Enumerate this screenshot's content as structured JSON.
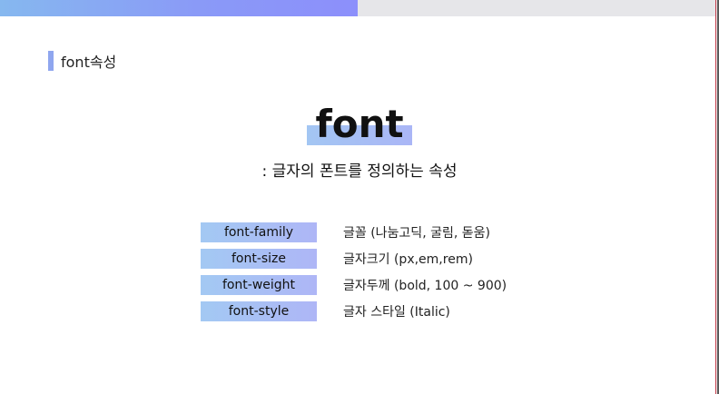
{
  "progress": {
    "fraction": 0.5,
    "fill_color": "#8a9af7",
    "track_color": "#e6e6e9"
  },
  "section": {
    "label": "font속성",
    "bar_color": "#8fa6ef"
  },
  "hero": {
    "word": "font",
    "subtitle": ": 글자의 폰트를 정의하는 속성"
  },
  "properties": [
    {
      "name": "font-family",
      "desc": "글꼴 (나눔고딕, 굴림, 돋움)"
    },
    {
      "name": "font-size",
      "desc": "글자크기 (px,em,rem)"
    },
    {
      "name": "font-weight",
      "desc": "글자두께 (bold, 100 ~ 900)"
    },
    {
      "name": "font-style",
      "desc": "글자 스타일 (Italic)"
    }
  ]
}
